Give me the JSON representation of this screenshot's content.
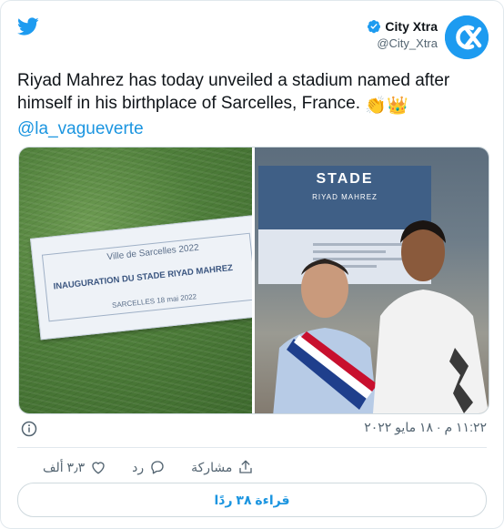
{
  "author": {
    "name": "City Xtra",
    "handle": "@City_Xtra"
  },
  "tweet": {
    "text": "Riyad Mahrez has today unveiled a stadium named after himself in his birthplace of Sarcelles, France.",
    "emojis": "👏👑",
    "mention": "@la_vagueverte"
  },
  "media": {
    "plaque": {
      "ville": "Ville de Sarcelles 2022",
      "title": "INAUGURATION DU STADE RIYAD MAHREZ",
      "date": "SARCELLES 18 mai 2022"
    },
    "sign": {
      "word": "STADE",
      "name": "RIYAD MAHREZ"
    }
  },
  "footer": {
    "timestamp": "١١:٢٢ م · ١٨ مايو ٢٠٢٢"
  },
  "actions": {
    "likes_count": "٣٫٣ ألف",
    "reply_label": "رد",
    "share_label": "مشاركة"
  },
  "reply_bar": {
    "label": "قراءة ٣٨ ردًا"
  },
  "colors": {
    "twitter_blue": "#1d9bf0",
    "link_blue": "#1b95e0",
    "muted": "#536471"
  }
}
